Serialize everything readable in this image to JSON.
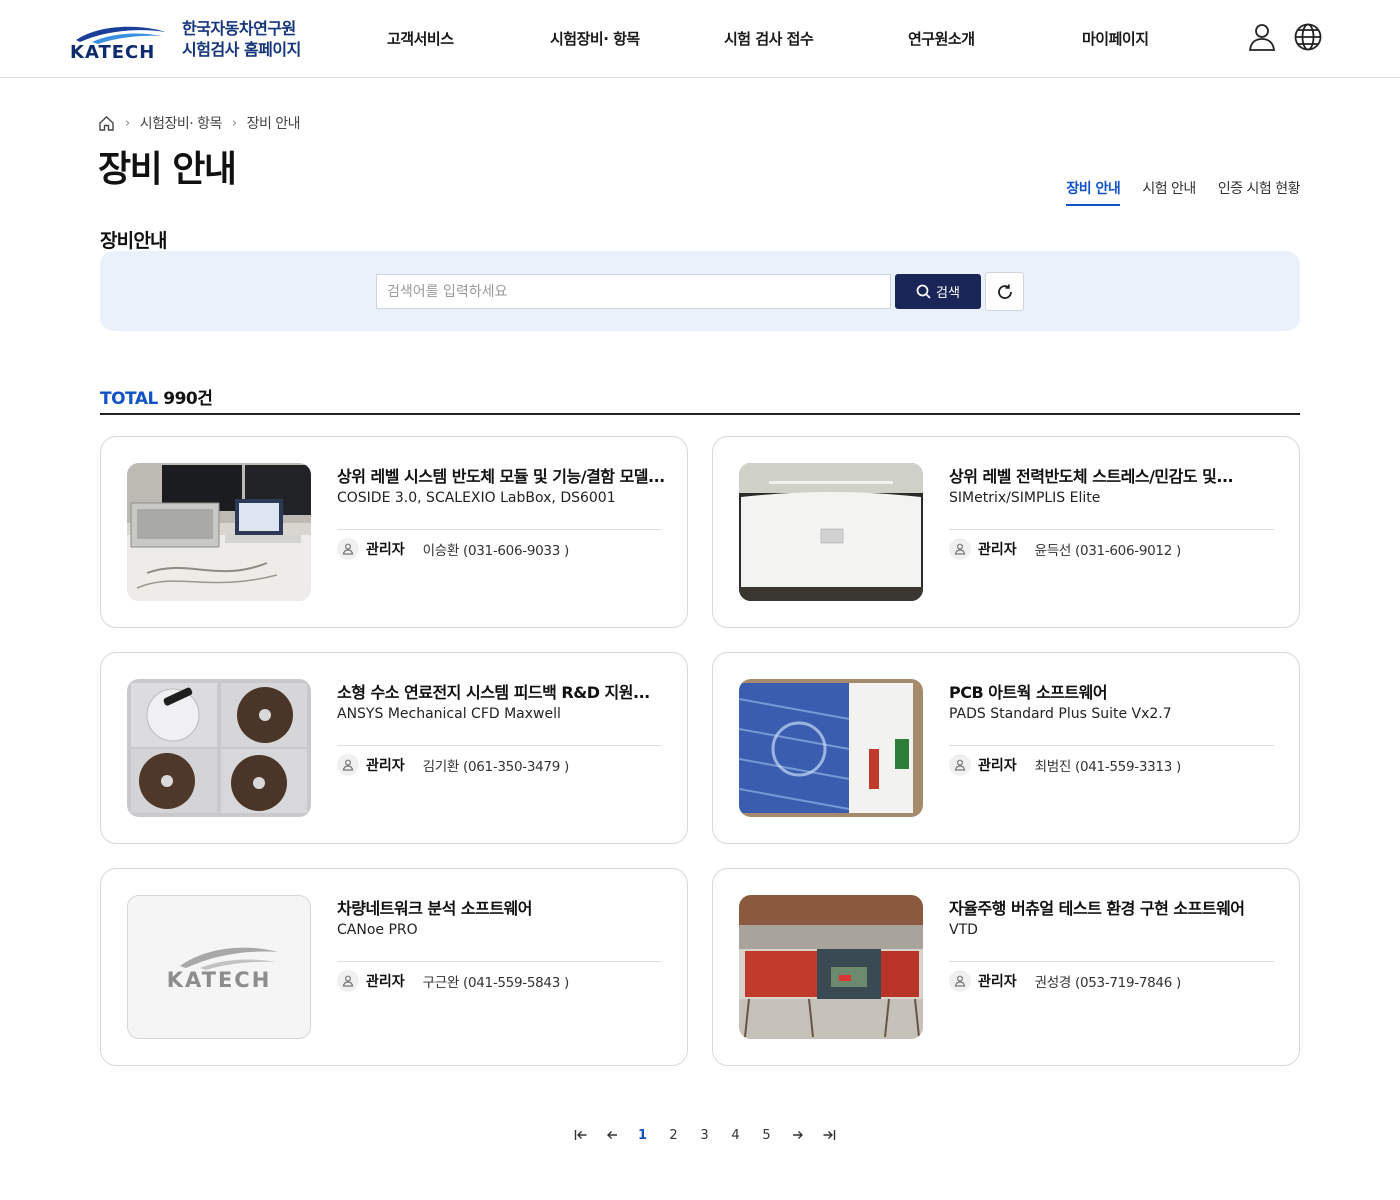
{
  "header": {
    "logo_word": "KATECH",
    "logo_line1": "한국자동차연구원",
    "logo_line2": "시험검사 홈페이지",
    "nav": [
      "고객서비스",
      "시험장비· 항목",
      "시험 검사 접수",
      "연구원소개",
      "마이페이지"
    ],
    "icons": [
      "user-icon",
      "globe-icon"
    ]
  },
  "breadcrumb": {
    "home_icon": "home-icon",
    "level1": "시험장비· 항목",
    "level2": "장비 안내"
  },
  "page_title": "장비 안내",
  "tabs": [
    {
      "label": "장비 안내",
      "active": true
    },
    {
      "label": "시험 안내",
      "active": false
    },
    {
      "label": "인증 시험 현황",
      "active": false
    }
  ],
  "section_title": "장비안내",
  "search": {
    "placeholder": "검색어를 입력하세요",
    "button_label": "검색",
    "reset_icon": "refresh-icon"
  },
  "total": {
    "label": "TOTAL",
    "count": "990건"
  },
  "manager_label": "관리자",
  "cards": [
    {
      "title": "상위 레벨 시스템 반도체 모듈 및 기능/결함 모델...",
      "subtitle": "COSIDE 3.0, SCALEXIO LabBox, DS6001",
      "manager": "이승환 (031-606-9033 )",
      "thumb": "lab-equipment-photo"
    },
    {
      "title": "상위 레벨 전력반도체 스트레스/민감도 및...",
      "subtitle": "SIMetrix/SIMPLIS Elite",
      "manager": "윤득선 (031-606-9012 )",
      "thumb": "monitor-photo"
    },
    {
      "title": "소형 수소 연료전지 시스템 피드백 R&D 지원...",
      "subtitle": "ANSYS Mechanical CFD Maxwell",
      "manager": "김기환 (061-350-3479 )",
      "thumb": "software-discs-photo"
    },
    {
      "title": "PCB 아트웍 소프트웨어",
      "subtitle": "PADS Standard Plus Suite Vx2.7",
      "manager": "최범진 (041-559-3313 )",
      "thumb": "software-box-photo"
    },
    {
      "title": "차량네트워크 분석 소프트웨어",
      "subtitle": "CANoe PRO",
      "manager": "구근완 (041-559-5843 )",
      "thumb": "katech-logo-placeholder",
      "placeholder_word": "KATECH"
    },
    {
      "title": "자율주행 버츄얼 테스트 환경 구현 소프트웨어",
      "subtitle": "VTD",
      "manager": "권성경 (053-719-7846 )",
      "thumb": "driving-simulator-photo"
    }
  ],
  "pagination": {
    "pages": [
      "1",
      "2",
      "3",
      "4",
      "5"
    ],
    "current": "1",
    "icons": [
      "first-page-icon",
      "prev-page-icon",
      "next-page-icon",
      "last-page-icon"
    ]
  },
  "colors": {
    "accent": "#1152c9",
    "navy": "#1a2657",
    "panel": "#eaf1fb"
  }
}
